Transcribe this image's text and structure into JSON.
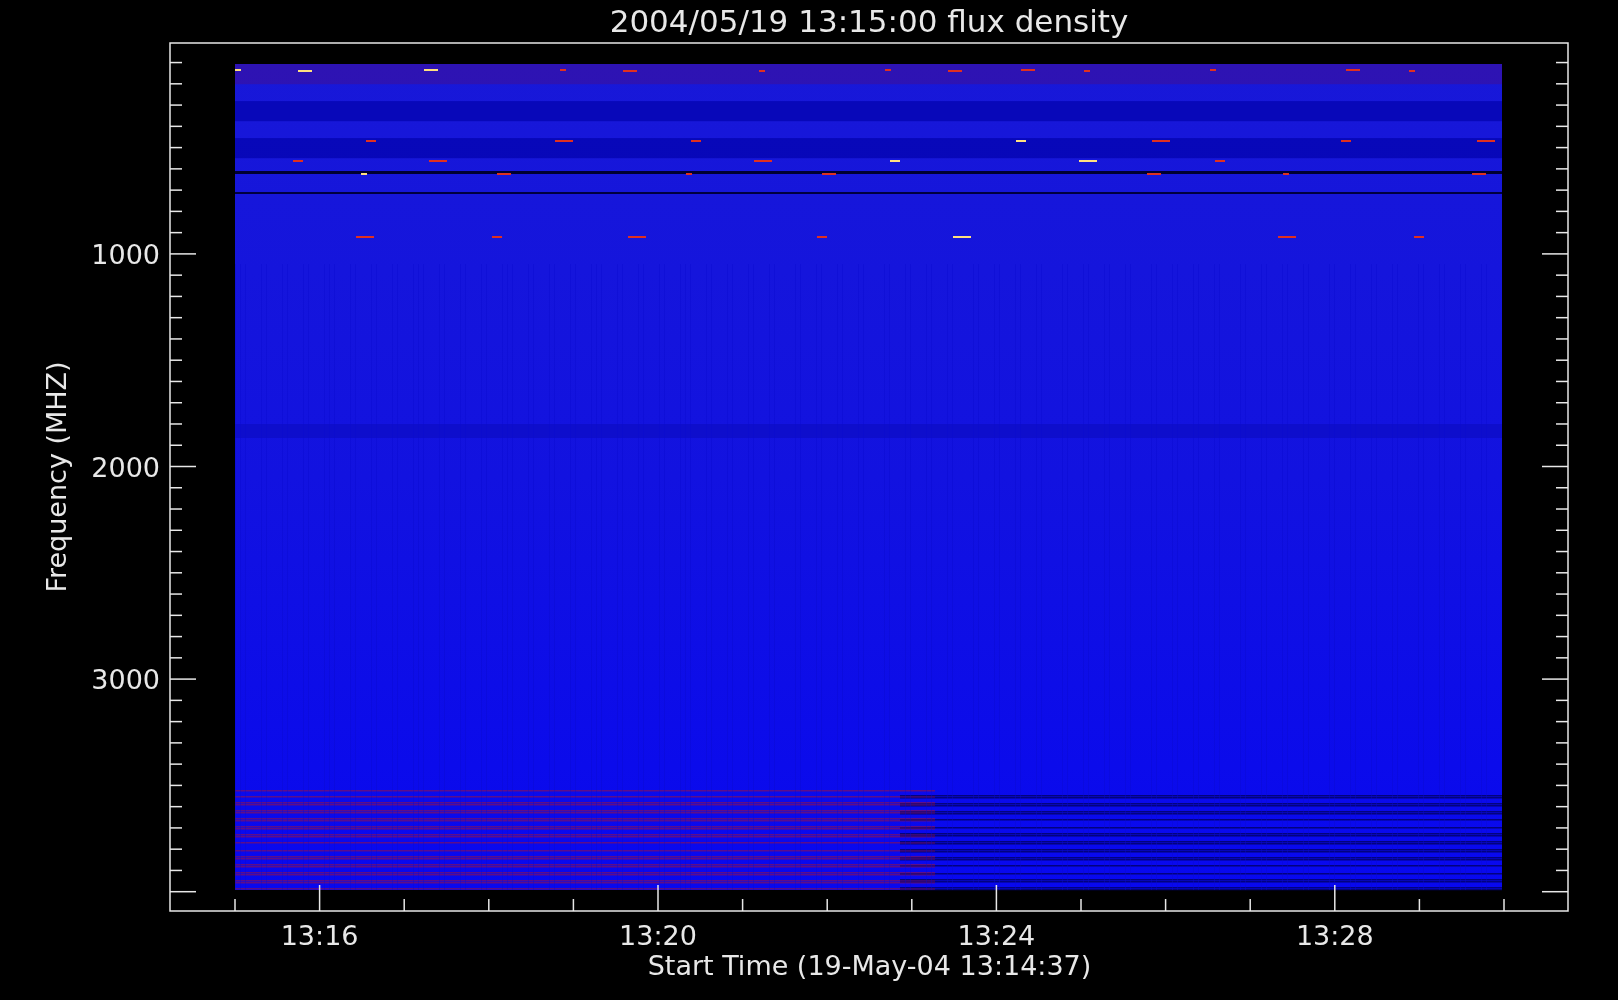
{
  "plot": {
    "title": "2004/05/19 13:15:00 flux density",
    "y_axis": {
      "label": "Frequency (MHZ)",
      "ticks": [
        "1000",
        "2000",
        "3000"
      ]
    },
    "x_axis": {
      "label": "Start Time (19-May-04 13:14:37)",
      "ticks": [
        "13:16",
        "13:20",
        "13:24",
        "13:28"
      ]
    }
  }
}
